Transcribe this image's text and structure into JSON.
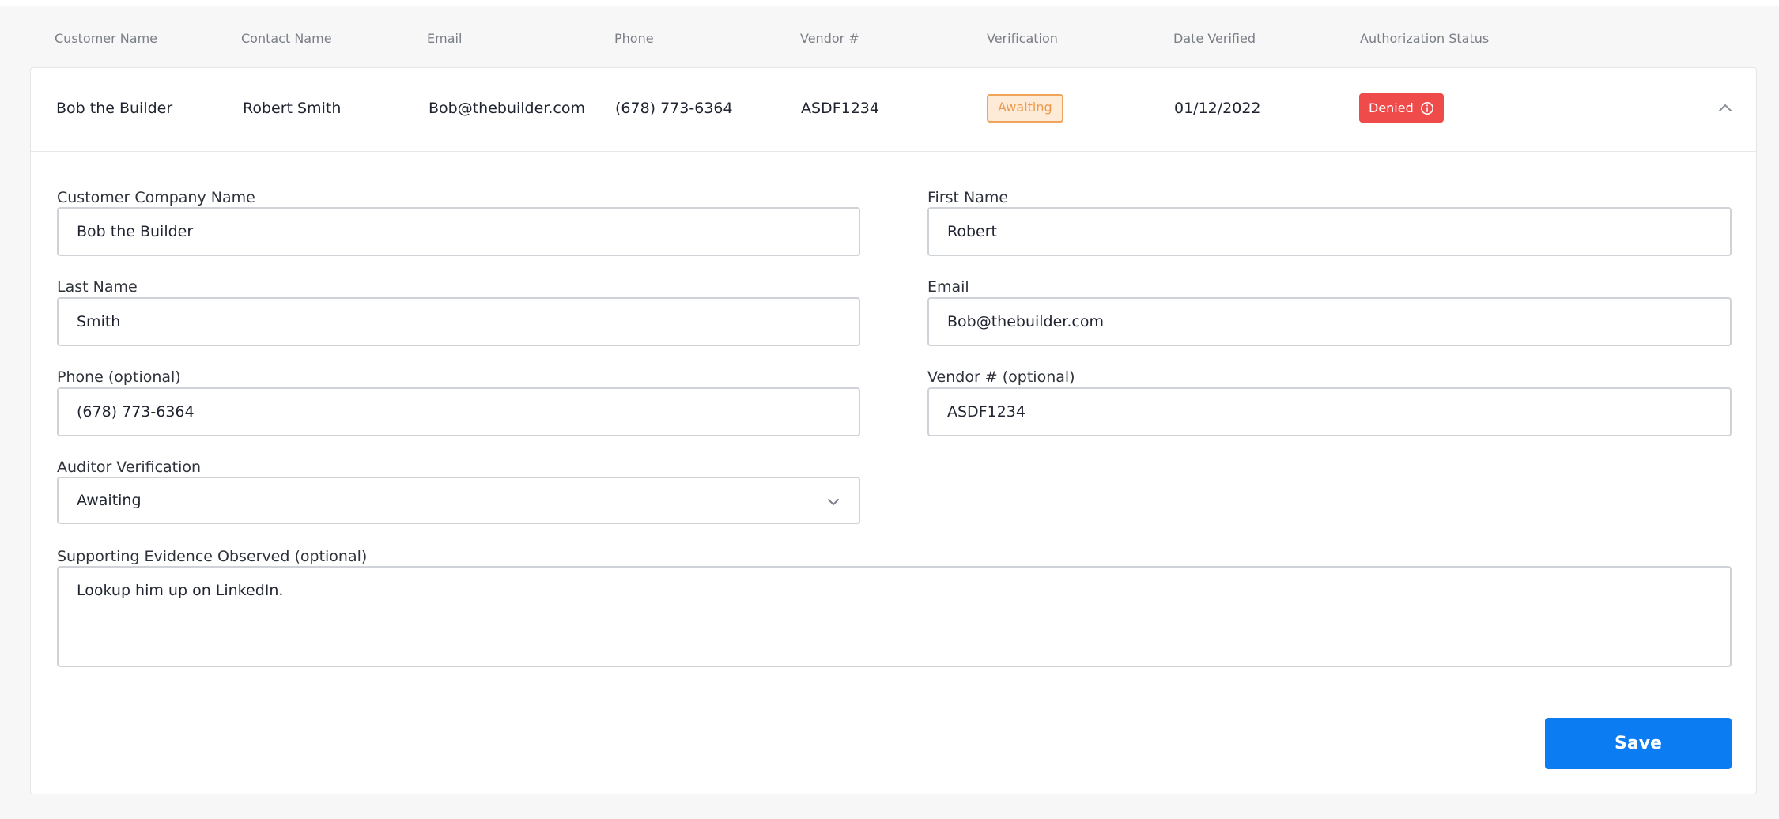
{
  "columns": {
    "customer_name": "Customer Name",
    "contact_name": "Contact Name",
    "email": "Email",
    "phone": "Phone",
    "vendor": "Vendor #",
    "verification": "Verification",
    "date_verified": "Date Verified",
    "authorization_status": "Authorization Status"
  },
  "row": {
    "customer_name": "Bob the Builder",
    "contact_name": "Robert Smith",
    "email": "Bob@thebuilder.com",
    "phone": "(678) 773-6364",
    "vendor": "ASDF1234",
    "verification": "Awaiting",
    "date_verified": "01/12/2022",
    "authorization_status": "Denied"
  },
  "form": {
    "customer_company_name": {
      "label": "Customer Company Name",
      "value": "Bob the Builder"
    },
    "first_name": {
      "label": "First Name",
      "value": "Robert"
    },
    "last_name": {
      "label": "Last Name",
      "value": "Smith"
    },
    "email": {
      "label": "Email",
      "value": "Bob@thebuilder.com"
    },
    "phone": {
      "label": "Phone (optional)",
      "value": "(678) 773-6364"
    },
    "vendor": {
      "label": "Vendor # (optional)",
      "value": "ASDF1234"
    },
    "auditor_verification": {
      "label": "Auditor Verification",
      "value": "Awaiting"
    },
    "supporting_evidence": {
      "label": "Supporting Evidence Observed (optional)",
      "value": "Lookup him up on LinkedIn."
    }
  },
  "actions": {
    "save_label": "Save"
  },
  "colors": {
    "awaiting": "#ee9a4c",
    "denied": "#f04b4b",
    "primary": "#0b7cf2"
  },
  "icons": {
    "info": "info-icon",
    "collapse": "chevron-up-icon",
    "dropdown": "chevron-down-icon"
  }
}
